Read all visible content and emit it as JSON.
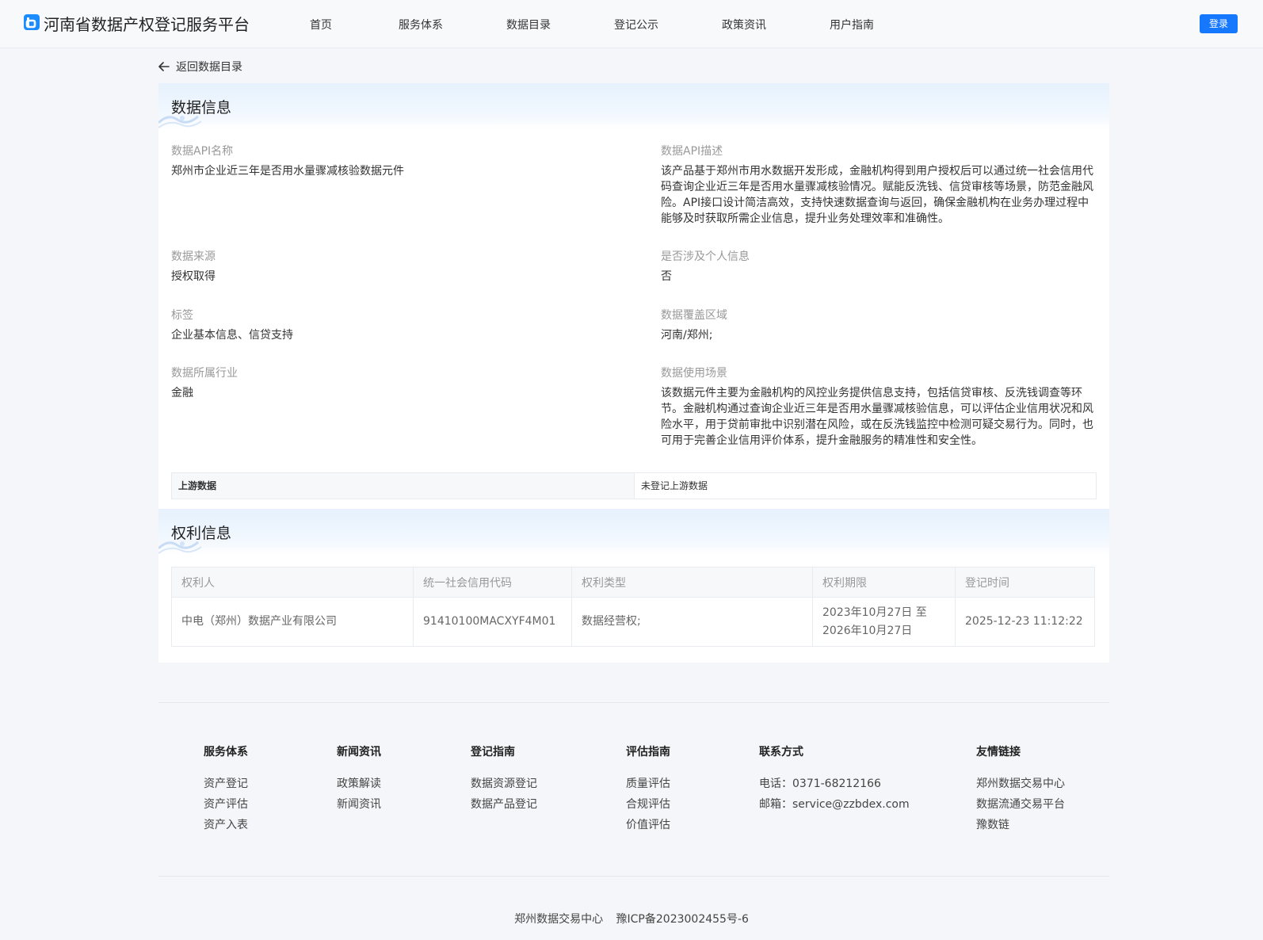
{
  "header": {
    "site_title": "河南省数据产权登记服务平台",
    "nav": [
      "首页",
      "服务体系",
      "数据目录",
      "登记公示",
      "政策资讯",
      "用户指南"
    ],
    "login_label": "登录",
    "brand_color": "#1677ff"
  },
  "back_label": "返回数据目录",
  "data_info": {
    "title": "数据信息",
    "api_name_label": "数据API名称",
    "api_name_value": "郑州市企业近三年是否用水量骤减核验数据元件",
    "api_desc_label": "数据API描述",
    "api_desc_value": "该产品基于郑州市用水数据开发形成，金融机构得到用户授权后可以通过统一社会信用代码查询企业近三年是否用水量骤减核验情况。赋能反洗钱、信贷审核等场景，防范金融风险。API接口设计简洁高效，支持快速数据查询与返回，确保金融机构在业务办理过程中能够及时获取所需企业信息，提升业务处理效率和准确性。",
    "source_label": "数据来源",
    "source_value": "授权取得",
    "personal_label": "是否涉及个人信息",
    "personal_value": "否",
    "tag_label": "标签",
    "tag_value": "企业基本信息、信贷支持",
    "region_label": "数据覆盖区域",
    "region_value": "河南/郑州;",
    "industry_label": "数据所属行业",
    "industry_value": "金融",
    "scene_label": "数据使用场景",
    "scene_value": "该数据元件主要为金融机构的风控业务提供信息支持，包括信贷审核、反洗钱调查等环节。金融机构通过查询企业近三年是否用水量骤减核验信息，可以评估企业信用状况和风险水平，用于贷前审批中识别潜在风险，或在反洗钱监控中检测可疑交易行为。同时，也可用于完善企业信用评价体系，提升金融服务的精准性和安全性。",
    "upstream_label": "上游数据",
    "upstream_value": "未登记上游数据"
  },
  "rights_info": {
    "title": "权利信息",
    "columns": [
      "权利人",
      "统一社会信用代码",
      "权利类型",
      "权利期限",
      "登记时间"
    ],
    "rows": [
      {
        "holder": "中电（郑州）数据产业有限公司",
        "credit_code": "91410100MACXYF4M01",
        "right_type": "数据经营权;",
        "term_line1": "2023年10月27日 至",
        "term_line2": "2026年10月27日",
        "reg_time": "2025-12-23 11:12:22"
      }
    ]
  },
  "footer": {
    "columns": [
      {
        "title": "服务体系",
        "links": [
          "资产登记",
          "资产评估",
          "资产入表"
        ]
      },
      {
        "title": "新闻资讯",
        "links": [
          "政策解读",
          "新闻资讯"
        ]
      },
      {
        "title": "登记指南",
        "links": [
          "数据资源登记",
          "数据产品登记"
        ]
      },
      {
        "title": "评估指南",
        "links": [
          "质量评估",
          "合规评估",
          "价值评估"
        ]
      },
      {
        "title": "联系方式",
        "links": [
          "电话：0371-68212166",
          "邮箱：service@zzbdex.com"
        ]
      },
      {
        "title": "友情链接",
        "links": [
          "郑州数据交易中心",
          "数据流通交易平台",
          "豫数链"
        ]
      }
    ],
    "org": "郑州数据交易中心",
    "icp": "豫ICP备2023002455号-6"
  }
}
